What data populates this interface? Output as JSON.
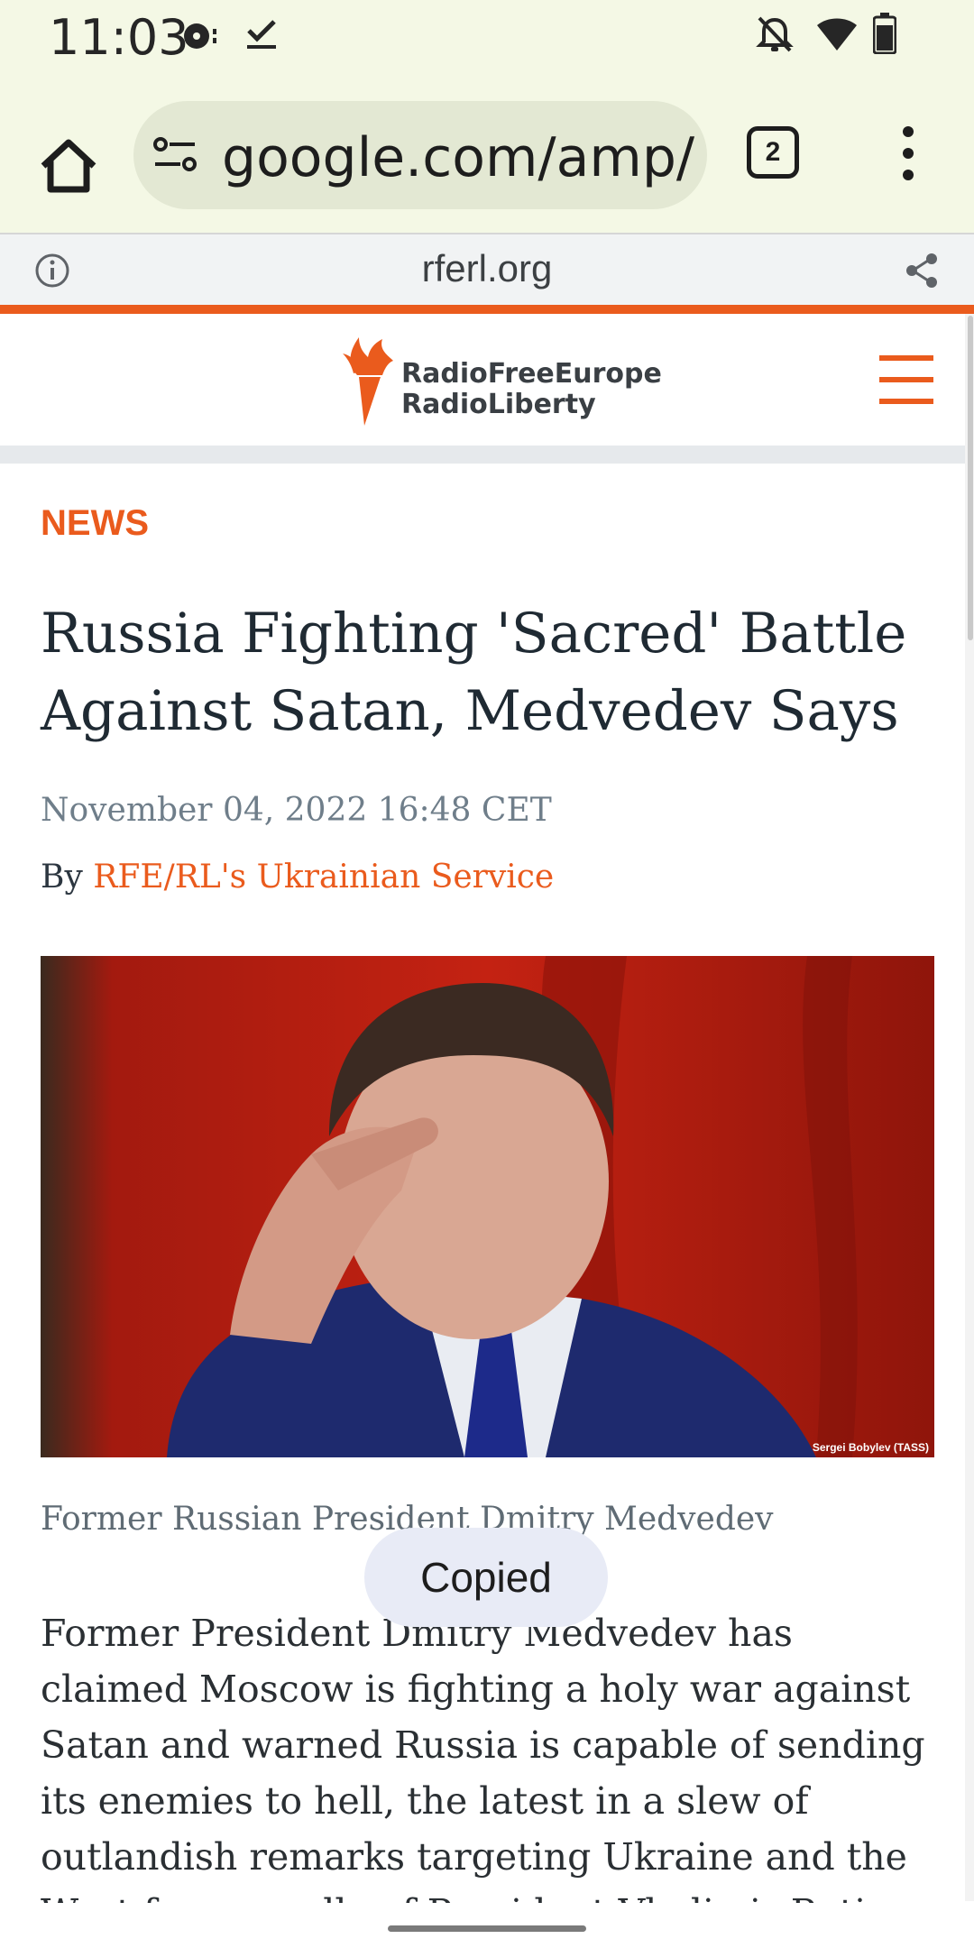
{
  "status_bar": {
    "time": "11:03",
    "icons": [
      "media-sync-icon",
      "check-icon",
      "notifications-off-icon",
      "wifi-icon",
      "battery-icon"
    ]
  },
  "browser": {
    "url": "google.com/amp/",
    "tab_count": "2",
    "amp_domain": "rferl.org"
  },
  "site": {
    "logo_line1": "RadioFreeEurope",
    "logo_line2": "RadioLiberty",
    "accent_color": "#ea5b1d"
  },
  "article": {
    "category": "NEWS",
    "headline": "Russia Fighting 'Sacred' Battle Against Satan, Medvedev Says",
    "date": "November 04, 2022 16:48 CET",
    "byline_prefix": "By ",
    "author": "RFE/RL's Ukrainian Service",
    "photo_credit": "Sergei Bobylev (TASS)",
    "caption": "Former Russian President Dmitry Medvedev",
    "body": "Former President Dmitry Medvedev has claimed Moscow is fighting a holy war against Satan and warned Russia is capable of sending its enemies to hell, the latest in a slew of outlandish remarks targeting Ukraine and the West from an ally of President Vladimir Putin who for years was touted"
  },
  "toast": {
    "text": "Copied"
  }
}
